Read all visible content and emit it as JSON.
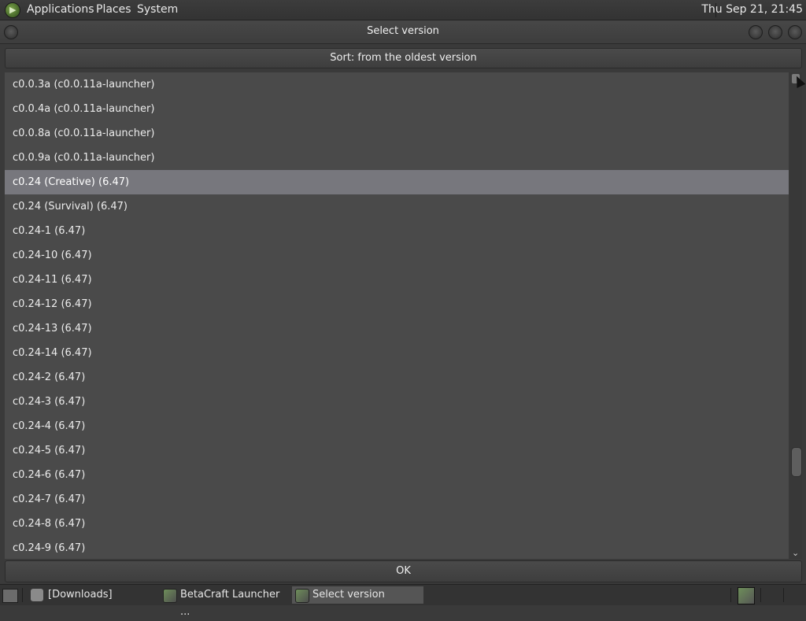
{
  "top_panel": {
    "menus": [
      "Applications",
      "Places",
      "System"
    ],
    "clock": "Thu Sep 21, 21:45"
  },
  "dialog": {
    "title": "Select version",
    "sort_label": "Sort: from the oldest version",
    "ok_label": "OK",
    "selected_index": 4,
    "versions": [
      "c0.0.3a (c0.0.11a-launcher)",
      "c0.0.4a (c0.0.11a-launcher)",
      "c0.0.8a (c0.0.11a-launcher)",
      "c0.0.9a (c0.0.11a-launcher)",
      "c0.24 (Creative) (6.47)",
      "c0.24 (Survival) (6.47)",
      "c0.24-1 (6.47)",
      "c0.24-10 (6.47)",
      "c0.24-11 (6.47)",
      "c0.24-12 (6.47)",
      "c0.24-13 (6.47)",
      "c0.24-14 (6.47)",
      "c0.24-2 (6.47)",
      "c0.24-3 (6.47)",
      "c0.24-4 (6.47)",
      "c0.24-5 (6.47)",
      "c0.24-6 (6.47)",
      "c0.24-7 (6.47)",
      "c0.24-8 (6.47)",
      "c0.24-9 (6.47)"
    ]
  },
  "taskbar": {
    "tasks": [
      {
        "label": "[Downloads]",
        "icon": "folder-icon"
      },
      {
        "label": "BetaCraft Launcher ...",
        "icon": "betacraft-icon"
      },
      {
        "label": "Select version",
        "icon": "betacraft-icon",
        "active": true
      }
    ]
  },
  "colors": {
    "panel": "#333333",
    "list_bg": "#4a4a4a",
    "selected_row": "#77777d"
  }
}
